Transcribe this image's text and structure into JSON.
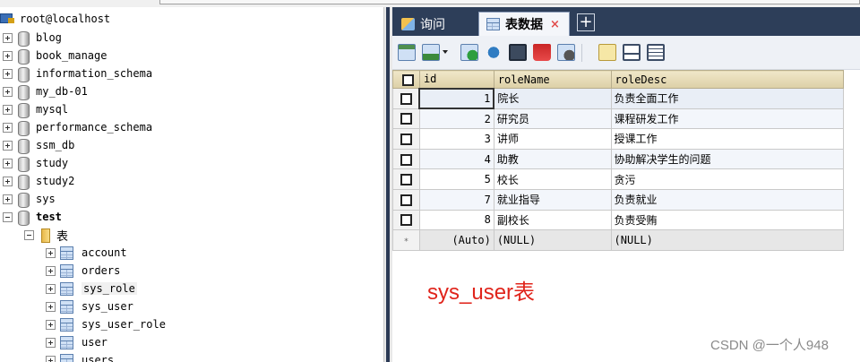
{
  "tree": {
    "server": "root@localhost",
    "databases": [
      "blog",
      "book_manage",
      "information_schema",
      "my_db-01",
      "mysql",
      "performance_schema",
      "ssm_db",
      "study",
      "study2",
      "sys"
    ],
    "open_db": "test",
    "tables_folder": "表",
    "tables": [
      "account",
      "orders",
      "sys_role",
      "sys_user",
      "sys_user_role",
      "user",
      "users"
    ]
  },
  "tabs": {
    "query_label": "询问",
    "data_label": "表数据",
    "close": "×",
    "add": "+"
  },
  "grid": {
    "columns": [
      "id",
      "roleName",
      "roleDesc"
    ],
    "rows": [
      [
        "1",
        "院长",
        "负责全面工作"
      ],
      [
        "2",
        "研究员",
        "课程研发工作"
      ],
      [
        "3",
        "讲师",
        "授课工作"
      ],
      [
        "4",
        "助教",
        "协助解决学生的问题"
      ],
      [
        "5",
        "校长",
        "贪污"
      ],
      [
        "7",
        "就业指导",
        "负责就业"
      ],
      [
        "8",
        "副校长",
        "负责受贿"
      ]
    ],
    "new_row": [
      "(Auto)",
      "(NULL)",
      "(NULL)"
    ],
    "new_row_marker": "*"
  },
  "caption": "sys_user表",
  "watermark": "CSDN @一个人948",
  "colors": {
    "tab_bar": "#2d3e59",
    "caption": "#e0241b",
    "header": "#dccfa6"
  }
}
